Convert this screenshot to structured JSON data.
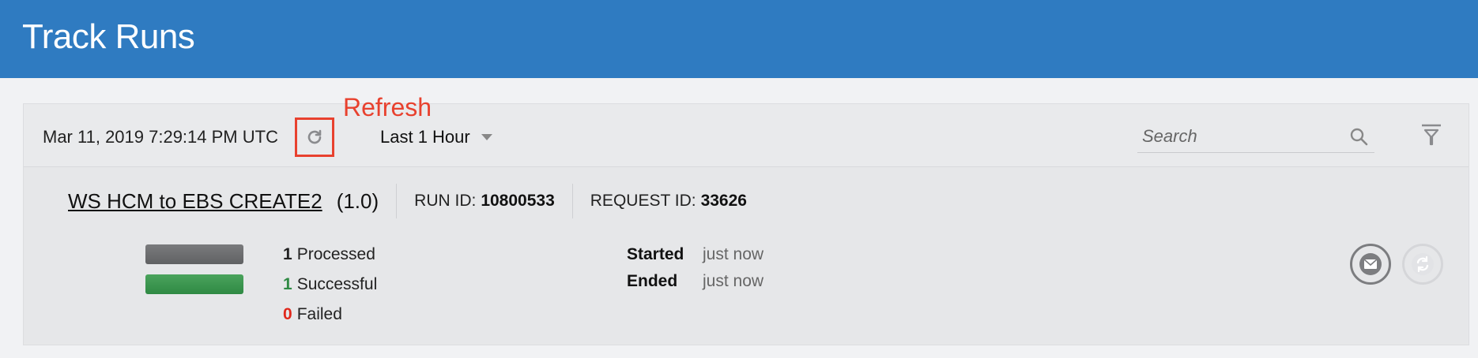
{
  "header": {
    "title": "Track Runs"
  },
  "toolbar": {
    "timestamp": "Mar 11, 2019 7:29:14 PM UTC",
    "refresh_annotation": "Refresh",
    "time_range": "Last 1 Hour",
    "search_placeholder": "Search"
  },
  "run": {
    "name": "WS HCM to EBS CREATE2",
    "version": "(1.0)",
    "run_id_label": "RUN ID:",
    "run_id": "10800533",
    "request_id_label": "REQUEST ID:",
    "request_id": "33626",
    "counts": [
      {
        "value": "1",
        "label": "Processed"
      },
      {
        "value": "1",
        "label": "Successful"
      },
      {
        "value": "0",
        "label": "Failed"
      }
    ],
    "started_label": "Started",
    "started_value": "just now",
    "ended_label": "Ended",
    "ended_value": "just now"
  },
  "colors": {
    "header": "#2f7bc1",
    "annotation": "#e8412e",
    "success": "#2f8a44",
    "failed": "#e0281c"
  },
  "icons": [
    "refresh-icon",
    "chevron-down-icon",
    "search-icon",
    "filter-icon",
    "envelope-icon",
    "resubmit-icon"
  ]
}
